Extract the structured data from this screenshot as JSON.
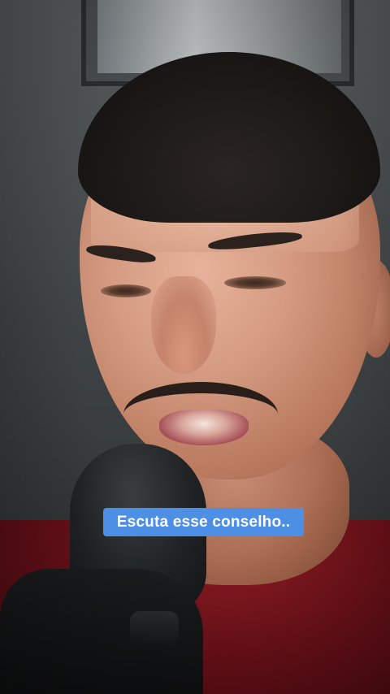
{
  "story": {
    "caption": "Escuta esse conselho..",
    "caption_bg_color": "#4e8fe6",
    "caption_text_color": "#ffffff"
  },
  "media": {
    "scene": "man speaking into a black microphone, red shirt, short dark hair and mustache",
    "scene_icons": [
      "microphone-icon"
    ]
  }
}
